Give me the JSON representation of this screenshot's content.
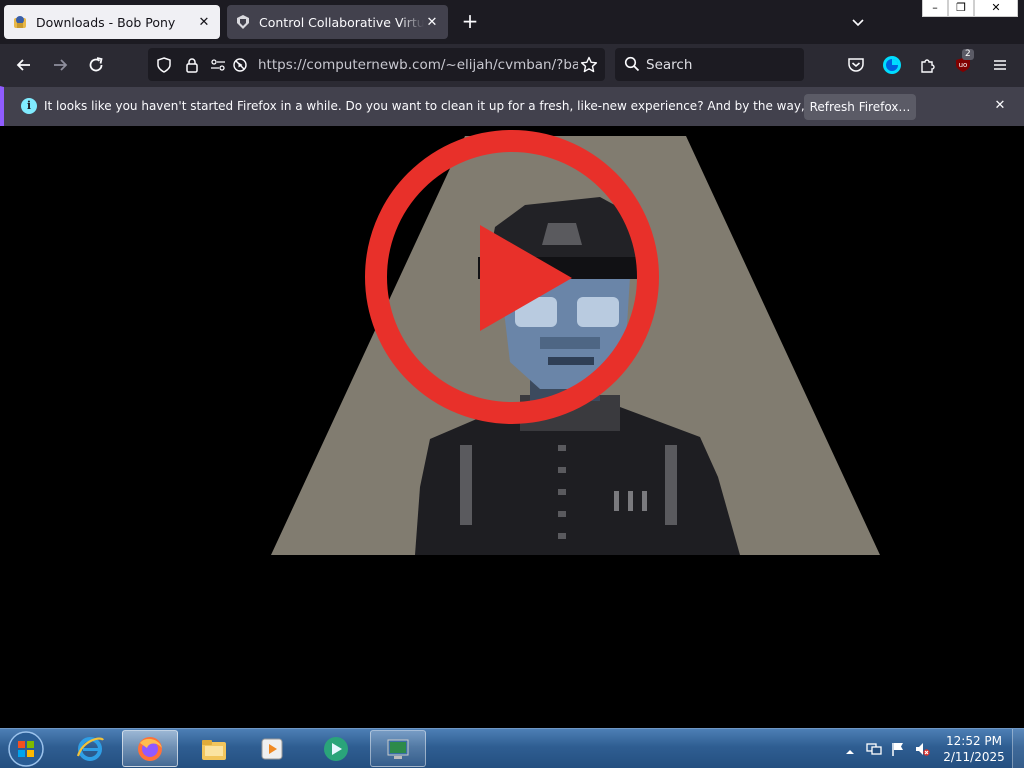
{
  "tabs": [
    {
      "title": "Downloads - Bob Pony",
      "active": false
    },
    {
      "title": "Control Collaborative Virtual Machines",
      "active": true
    }
  ],
  "window_controls": {
    "minimize": "–",
    "maximize": "❐",
    "close": "✕"
  },
  "nav": {
    "url": "https://computernewb.com/~elijah/cvmban/?banreason",
    "url_domain": "computernewb.com",
    "search_placeholder": "Search",
    "extension_badge": "2"
  },
  "notification": {
    "message": "It looks like you haven't started Firefox in a while. Do you want to clean it up for a fresh, like-new experience? And by the way, welcome back!",
    "button": "Refresh Firefox…"
  },
  "taskbar": {
    "time": "12:52 PM",
    "date": "2/11/2025"
  },
  "colors": {
    "accent": "#8f5cff",
    "play_red": "#e8302a",
    "spotlight": "#817c70"
  }
}
